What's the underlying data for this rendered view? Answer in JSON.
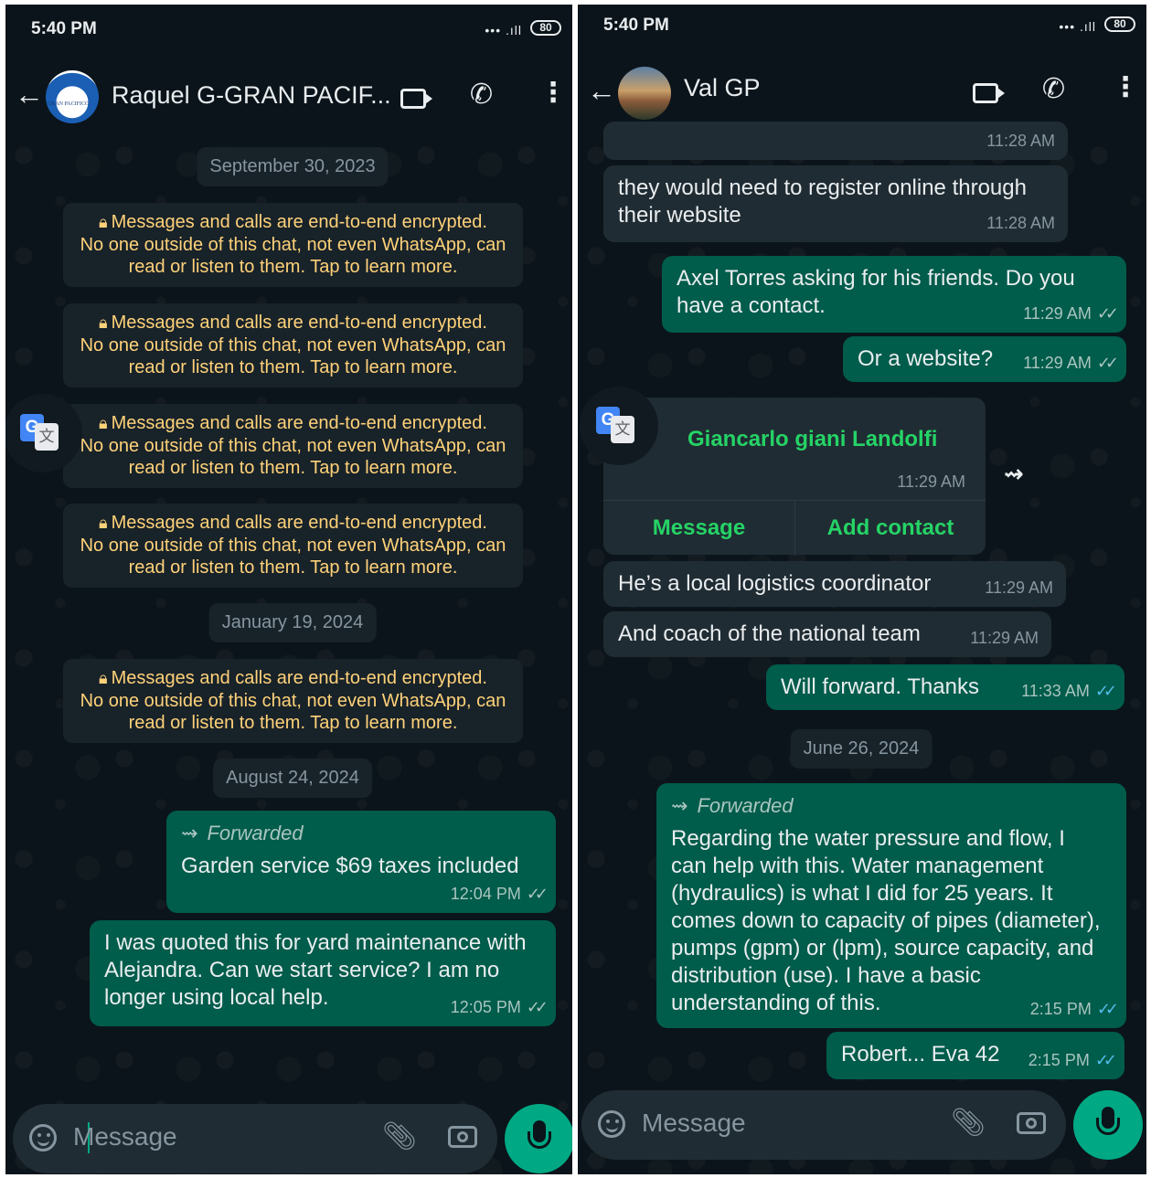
{
  "left": {
    "status_time": "5:40 PM",
    "battery": "80",
    "contact_name": "Raquel G-GRAN PACIF...",
    "date1": "September 30, 2023",
    "enc_line1": "Messages and calls are end-to-end encrypted.",
    "enc_line2": "No one outside of this chat, not even WhatsApp, can",
    "enc_line3": "read or listen to them. Tap to learn more.",
    "enc_line2_partial": " one outside of this chat, not even WhatsApp, can",
    "date2": "January 19, 2024",
    "date3": "August 24, 2024",
    "forwarded_label": "Forwarded",
    "msg1_text": "Garden service $69 taxes included",
    "msg1_time": "12:04 PM",
    "msg2_text": "I was quoted this for yard maintenance with Alejandra. Can we start service? I am no longer using local help.",
    "msg2_time": "12:05 PM",
    "input_placeholder": "Message"
  },
  "right": {
    "status_time": "5:40 PM",
    "battery": "80",
    "contact_name": "Val GP",
    "msg0_time": "11:28 AM",
    "msg1_text": "they would need to register online through their website",
    "msg1_time": "11:28 AM",
    "msg2_text": "Axel Torres asking for his friends. Do you have a contact.",
    "msg2_time": "11:29 AM",
    "msg3_text": "Or a website?",
    "msg3_time": "11:29 AM",
    "card_name": "Giancarlo giani Landolfi",
    "card_time": "11:29 AM",
    "card_message_btn": "Message",
    "card_add_btn": "Add contact",
    "msg4_text": "He’s a local logistics coordinator",
    "msg4_time": "11:29 AM",
    "msg5_text": "And coach of the national team",
    "msg5_time": "11:29 AM",
    "msg6_text": "Will forward. Thanks",
    "msg6_time": "11:33 AM",
    "date1": "June 26, 2024",
    "forwarded_label": "Forwarded",
    "msg7_text": "Regarding the water pressure and flow, I can help with this. Water management (hydraulics) is what I did for 25 years. It comes down to capacity of pipes (diameter), pumps (gpm) or (lpm), source capacity, and distribution (use). I have a basic understanding of this.",
    "msg7_time": "2:15 PM",
    "msg8_text": "Robert... Eva 42",
    "msg8_time": "2:15 PM",
    "input_placeholder": "Message"
  },
  "icons": {
    "back": "arrow-left-icon",
    "video": "video-call-icon",
    "phone": "phone-icon",
    "menu": "kebab-menu-icon",
    "lock": "lock-icon",
    "emoji": "emoji-icon",
    "attach": "paperclip-icon",
    "camera": "camera-icon",
    "mic": "microphone-icon",
    "translate": "google-translate-icon",
    "forward": "forward-icon",
    "read_receipt": "double-check-icon"
  },
  "colors": {
    "background": "#0b141a",
    "outgoing_bubble": "#005c4b",
    "incoming_bubble": "#202c33",
    "accent": "#00a884",
    "link_green": "#25d366",
    "system_notice_text": "#ffd279",
    "read_tick_blue": "#53bdeb"
  }
}
